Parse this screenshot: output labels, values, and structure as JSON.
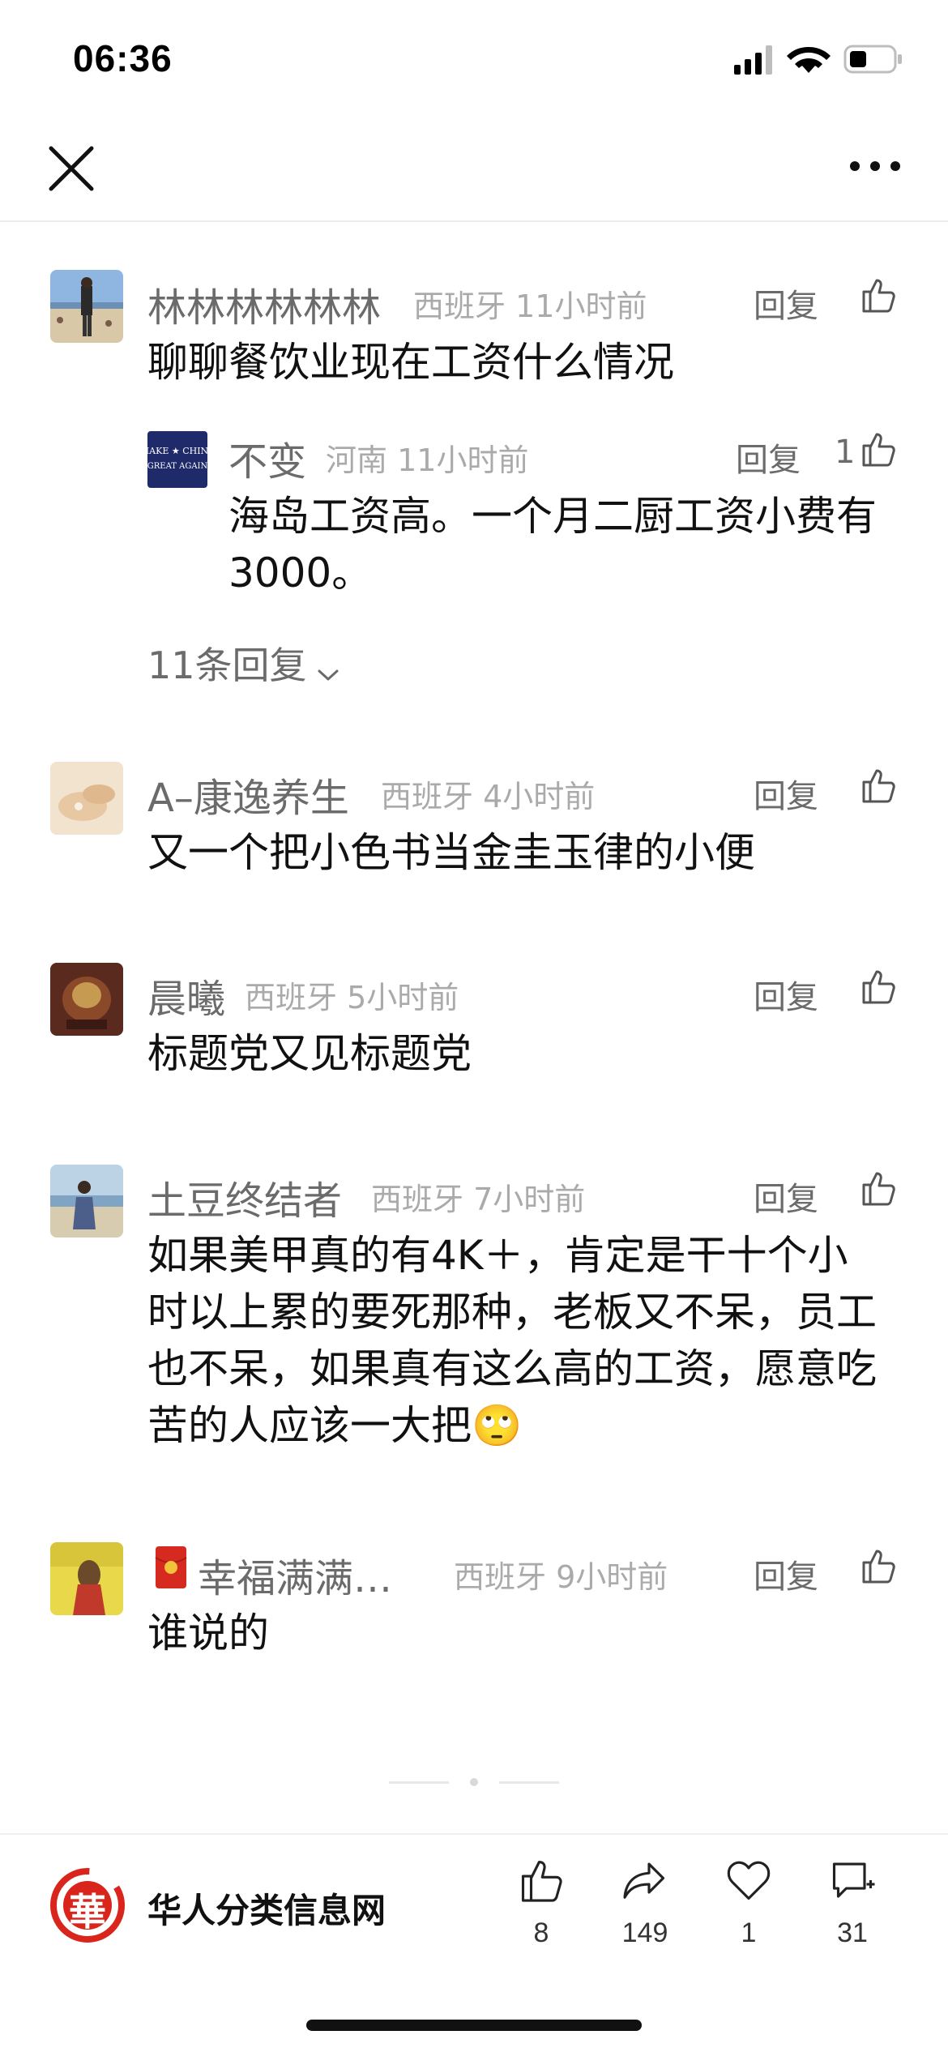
{
  "status_bar": {
    "time": "06:36"
  },
  "nav": {
    "close_icon": "close-icon",
    "more_icon": "more-horizontal-icon"
  },
  "comments": [
    {
      "username": "林林林林林林",
      "location": "西班牙",
      "time": "11小时前",
      "reply_label": "回复",
      "like_count": "",
      "text": "聊聊餐饮业现在工资什么情况",
      "replies": [
        {
          "username": "不变",
          "location": "河南",
          "time": "11小时前",
          "reply_label": "回复",
          "like_count": "1",
          "text": "海岛工资高。一个月二厨工资小费有3000。"
        }
      ],
      "more_replies_label": "11条回复"
    },
    {
      "username": "A–康逸养生",
      "location": "西班牙",
      "time": "4小时前",
      "reply_label": "回复",
      "like_count": "",
      "text": "又一个把小色书当金圭玉律的小便"
    },
    {
      "username": "晨曦",
      "location": "西班牙",
      "time": "5小时前",
      "reply_label": "回复",
      "like_count": "",
      "text": "标题党又见标题党"
    },
    {
      "username": "土豆终结者",
      "location": "西班牙",
      "time": "7小时前",
      "reply_label": "回复",
      "like_count": "",
      "text": "如果美甲真的有4K＋，肯定是干十个小时以上累的要死那种，老板又不呆，员工也不呆，如果真有这么高的工资，愿意吃苦的人应该一大把🙄"
    },
    {
      "username": "幸福满满…",
      "location": "西班牙",
      "time": "9小时前",
      "reply_label": "回复",
      "like_count": "",
      "text": "谁说的"
    }
  ],
  "bottom_bar": {
    "brand_name": "华人分类信息网",
    "brand_logo_text": "華",
    "actions": [
      {
        "name": "like",
        "icon": "thumbs-up-icon",
        "count": "8"
      },
      {
        "name": "share",
        "icon": "share-icon",
        "count": "149"
      },
      {
        "name": "favorite",
        "icon": "heart-icon",
        "count": "1"
      },
      {
        "name": "comment",
        "icon": "comment-add-icon",
        "count": "31"
      }
    ]
  },
  "colors": {
    "text_primary": "#111111",
    "text_secondary": "#6b6b6b",
    "text_meta": "#aaaaaa",
    "brand_red": "#d9251c"
  }
}
